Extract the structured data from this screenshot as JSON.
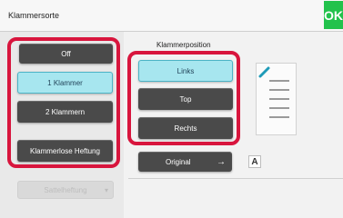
{
  "header": {
    "title": "Klammersorte",
    "ok_label": "OK"
  },
  "staple_options": [
    {
      "label": "Off"
    },
    {
      "label": "1 Klammer"
    },
    {
      "label": "2 Klammern"
    },
    {
      "label": "Klammerlose Heftung"
    }
  ],
  "saddle_button": {
    "label": "Sattelheftung"
  },
  "position": {
    "label": "Klammerposition",
    "options": [
      {
        "label": "Links"
      },
      {
        "label": "Top"
      },
      {
        "label": "Rechts"
      }
    ]
  },
  "original_button": {
    "label": "Original"
  },
  "orientation_icon": {
    "glyph": "A"
  },
  "colors": {
    "highlight_red": "#d8153d",
    "ok_green": "#22c24c",
    "selected_cyan": "#a7e6ef",
    "button_dark": "#4a4a4a",
    "staple_mark_cyan": "#1f9bb8"
  }
}
